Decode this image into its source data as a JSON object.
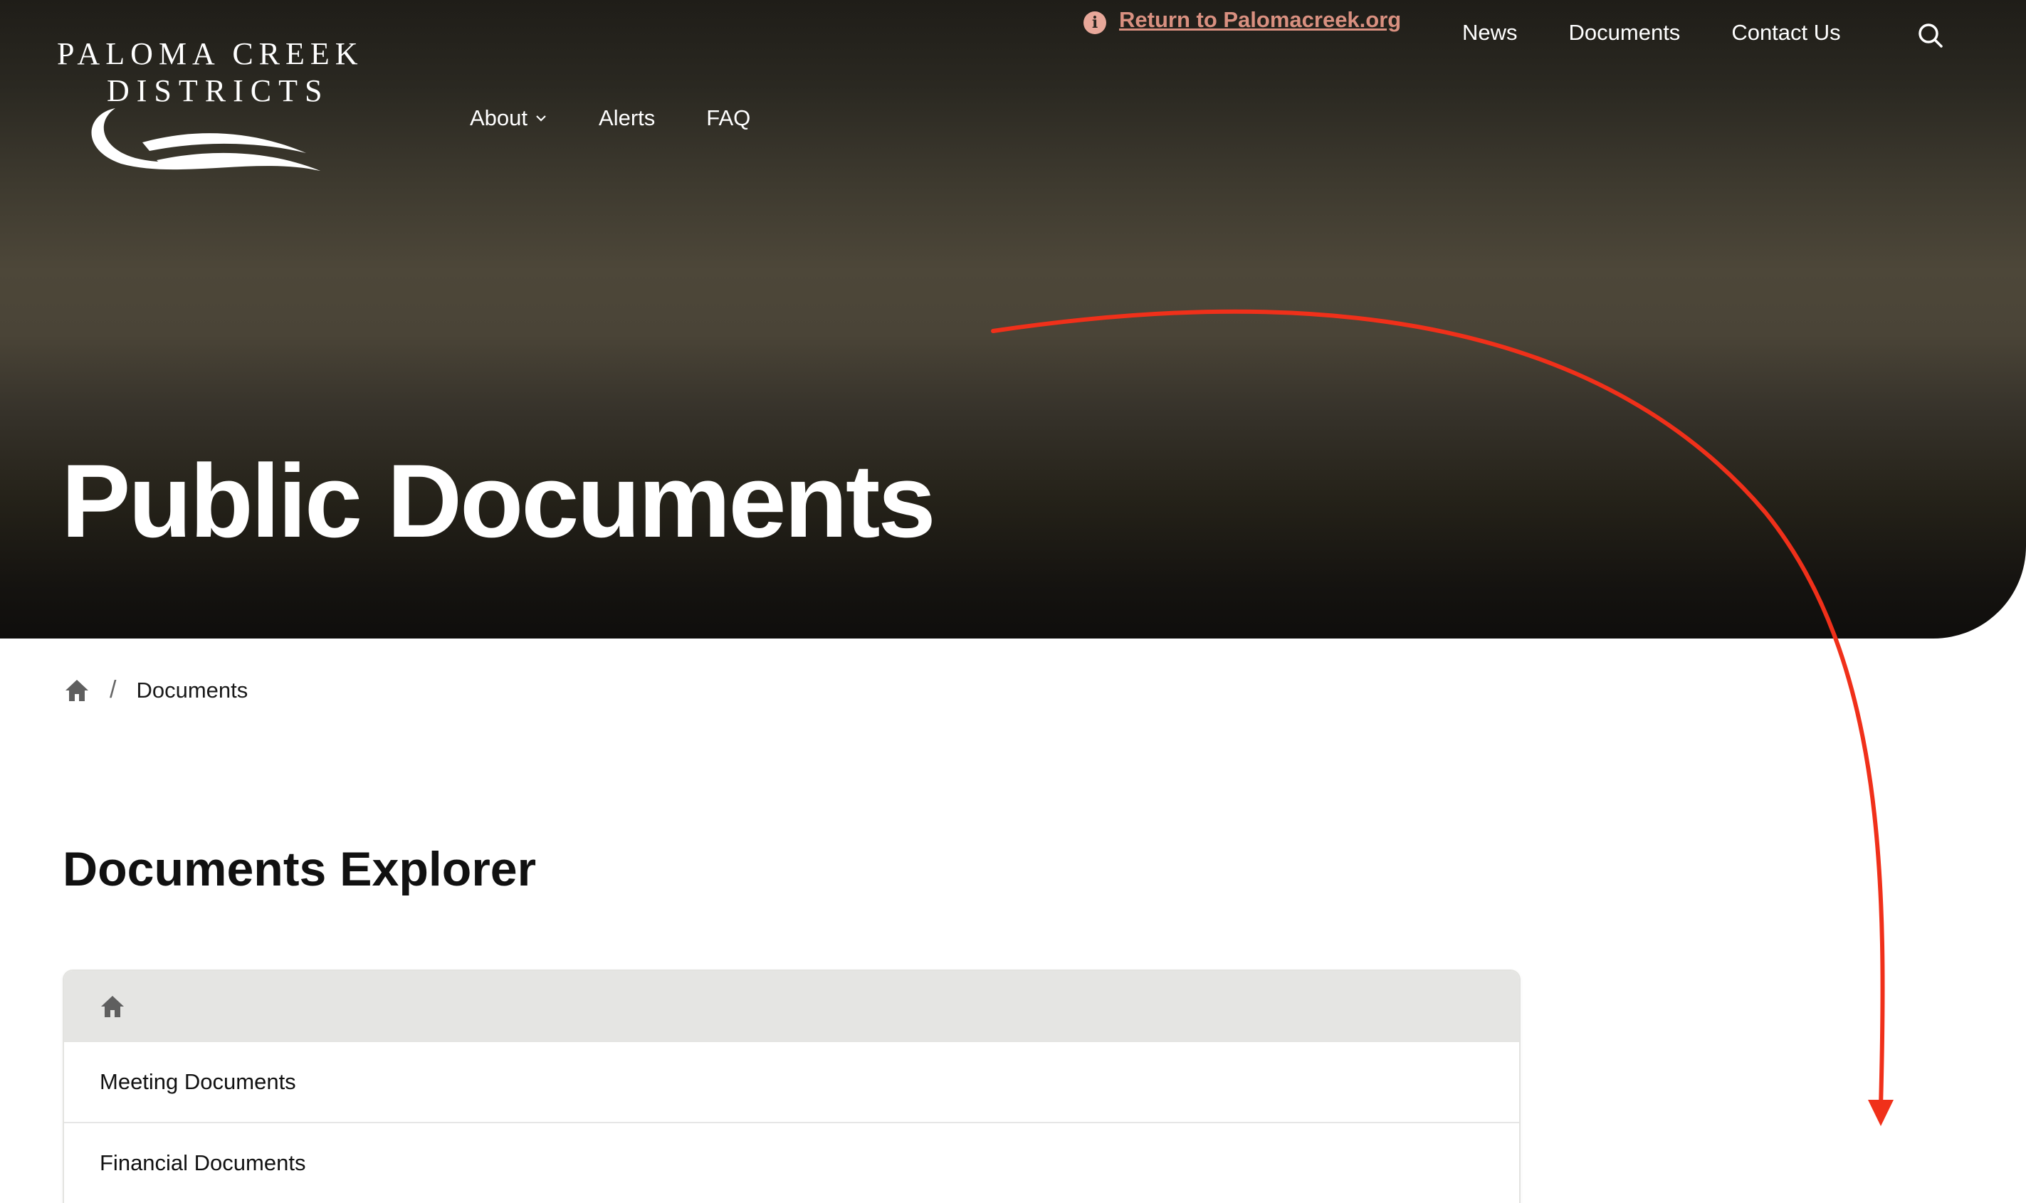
{
  "logo": {
    "line1": "PALOMA CREEK",
    "line2": "DISTRICTS"
  },
  "utility": {
    "return_link": "Return to Palomacreek.org"
  },
  "top_nav": [
    {
      "label": "News"
    },
    {
      "label": "Documents"
    },
    {
      "label": "Contact Us"
    }
  ],
  "main_nav": [
    {
      "label": "About"
    },
    {
      "label": "Alerts"
    },
    {
      "label": "FAQ"
    }
  ],
  "hero": {
    "title": "Public Documents"
  },
  "breadcrumb": {
    "separator": "/",
    "current": "Documents"
  },
  "section": {
    "title": "Documents Explorer"
  },
  "explorer": {
    "items": [
      {
        "label": "Meeting Documents"
      },
      {
        "label": "Financial Documents"
      }
    ]
  },
  "colors": {
    "accent_link": "#d99080",
    "annotation_arrow": "#f0301a",
    "explorer_header_bg": "#e5e5e3"
  },
  "icons": {
    "info": "info-icon",
    "search": "search-icon",
    "chevron": "chevron-down-icon",
    "home": "home-icon"
  }
}
